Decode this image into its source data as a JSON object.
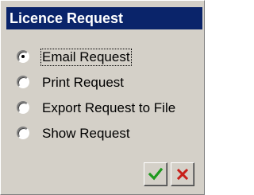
{
  "window": {
    "title": "Licence Request"
  },
  "options": [
    {
      "label": "Email Request",
      "selected": true
    },
    {
      "label": "Print Request",
      "selected": false
    },
    {
      "label": "Export Request to File",
      "selected": false
    },
    {
      "label": "Show Request",
      "selected": false
    }
  ],
  "buttons": {
    "ok_icon": "checkmark-icon",
    "cancel_icon": "x-icon"
  },
  "colors": {
    "titlebar": "#0a246a",
    "window_bg": "#d4d0c8",
    "ok_green": "#1f9a1f",
    "cancel_red": "#c8201a"
  }
}
